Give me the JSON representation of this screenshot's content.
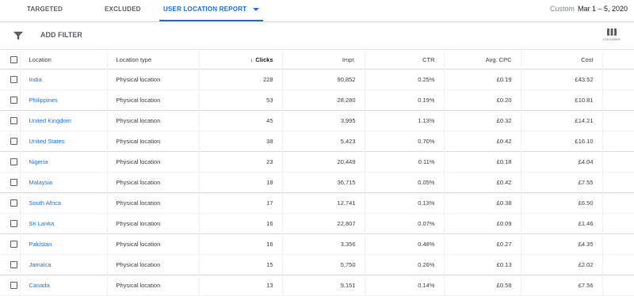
{
  "tabs": [
    {
      "label": "TARGETED"
    },
    {
      "label": "EXCLUDED"
    },
    {
      "label": "USER LOCATION REPORT"
    }
  ],
  "date_range": {
    "label": "Custom",
    "value": "Mar 1 – 5, 2020"
  },
  "toolbar": {
    "add_filter": "ADD FILTER",
    "columns": "COLUMNS"
  },
  "table": {
    "columns": [
      "Location",
      "Location type",
      "Clicks",
      "Impr.",
      "CTR",
      "Avg. CPC",
      "Cost"
    ],
    "sorted_column": "Clicks",
    "sort_direction": "descending",
    "rows": [
      {
        "location": "India",
        "type": "Physical location",
        "clicks": "228",
        "impr": "90,852",
        "ctr": "0.25%",
        "cpc": "£0.19",
        "cost": "£43.52"
      },
      {
        "location": "Philippines",
        "type": "Physical location",
        "clicks": "53",
        "impr": "28,280",
        "ctr": "0.19%",
        "cpc": "£0.20",
        "cost": "£10.81"
      },
      {
        "location": "United Kingdom",
        "type": "Physical location",
        "clicks": "45",
        "impr": "3,995",
        "ctr": "1.13%",
        "cpc": "£0.32",
        "cost": "£14.21"
      },
      {
        "location": "United States",
        "type": "Physical location",
        "clicks": "38",
        "impr": "5,423",
        "ctr": "0.70%",
        "cpc": "£0.42",
        "cost": "£16.10"
      },
      {
        "location": "Nigeria",
        "type": "Physical location",
        "clicks": "23",
        "impr": "20,449",
        "ctr": "0.11%",
        "cpc": "£0.18",
        "cost": "£4.04"
      },
      {
        "location": "Malaysia",
        "type": "Physical location",
        "clicks": "18",
        "impr": "36,715",
        "ctr": "0.05%",
        "cpc": "£0.42",
        "cost": "£7.55"
      },
      {
        "location": "South Africa",
        "type": "Physical location",
        "clicks": "17",
        "impr": "12,741",
        "ctr": "0.13%",
        "cpc": "£0.38",
        "cost": "£6.50"
      },
      {
        "location": "Sri Lanka",
        "type": "Physical location",
        "clicks": "16",
        "impr": "22,807",
        "ctr": "0.07%",
        "cpc": "£0.09",
        "cost": "£1.46"
      },
      {
        "location": "Pakistan",
        "type": "Physical location",
        "clicks": "16",
        "impr": "3,356",
        "ctr": "0.48%",
        "cpc": "£0.27",
        "cost": "£4.35"
      },
      {
        "location": "Jamaica",
        "type": "Physical location",
        "clicks": "15",
        "impr": "5,750",
        "ctr": "0.26%",
        "cpc": "£0.13",
        "cost": "£2.02"
      },
      {
        "location": "Canada",
        "type": "Physical location",
        "clicks": "13",
        "impr": "9,151",
        "ctr": "0.14%",
        "cpc": "£0.58",
        "cost": "£7.56"
      }
    ]
  },
  "colors": {
    "accent": "#1a73e8",
    "text": "#3c4043",
    "muted": "#5f6368"
  }
}
